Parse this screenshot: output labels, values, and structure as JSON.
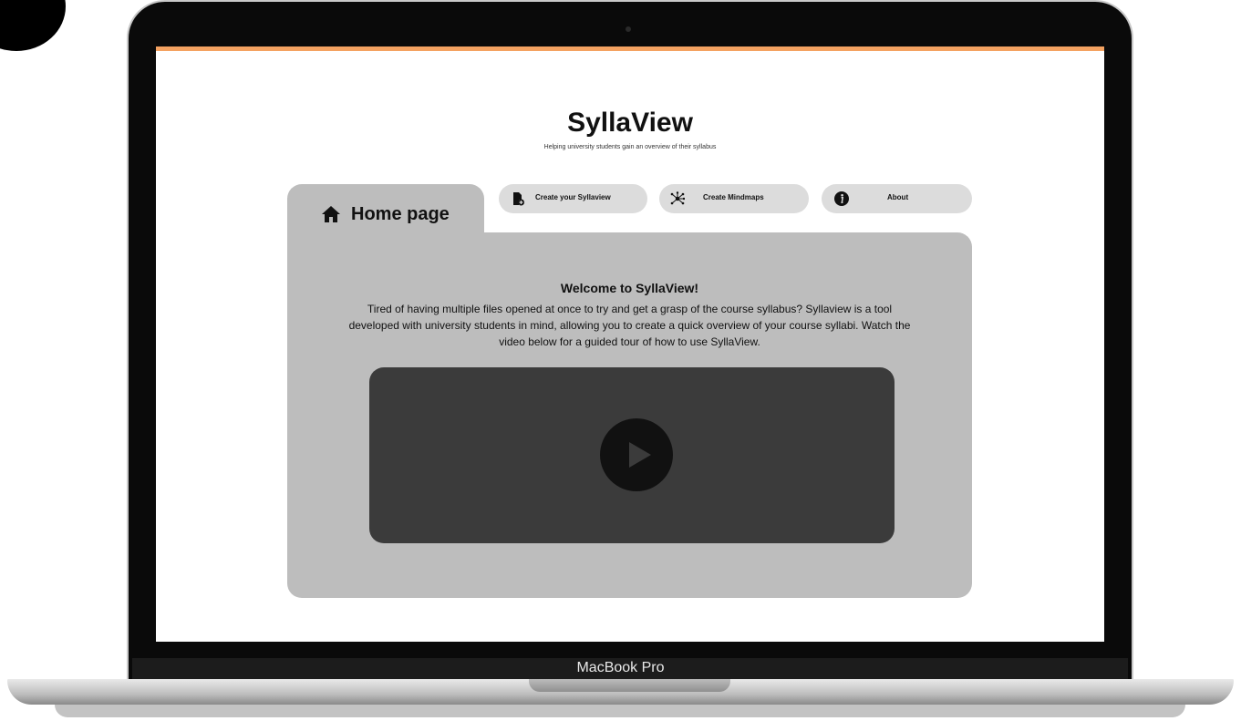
{
  "device": {
    "label": "MacBook Pro"
  },
  "app": {
    "title": "SyllaView",
    "subtitle": "Helping university students gain an overview of their syllabus"
  },
  "tabs": {
    "active": {
      "label": "Home page",
      "icon": "home-icon"
    },
    "nav": [
      {
        "label": "Create your Syllaview",
        "icon": "document-add-icon"
      },
      {
        "label": "Create Mindmaps",
        "icon": "mindmap-icon"
      },
      {
        "label": "About",
        "icon": "info-icon"
      }
    ]
  },
  "welcome": {
    "heading": "Welcome to SyllaView!",
    "body": "Tired of having multiple files opened at once to try and get a grasp of the course syllabus? Syllaview is a tool developed with university students in mind, allowing you to create a quick overview of your course syllabi. Watch the video below for a guided tour of how to use SyllaView."
  },
  "video": {
    "icon": "play-icon"
  },
  "colors": {
    "accent": "#f4a261",
    "panel": "#bdbdbd",
    "pill": "#dcdcdc",
    "video": "#3b3b3b"
  }
}
